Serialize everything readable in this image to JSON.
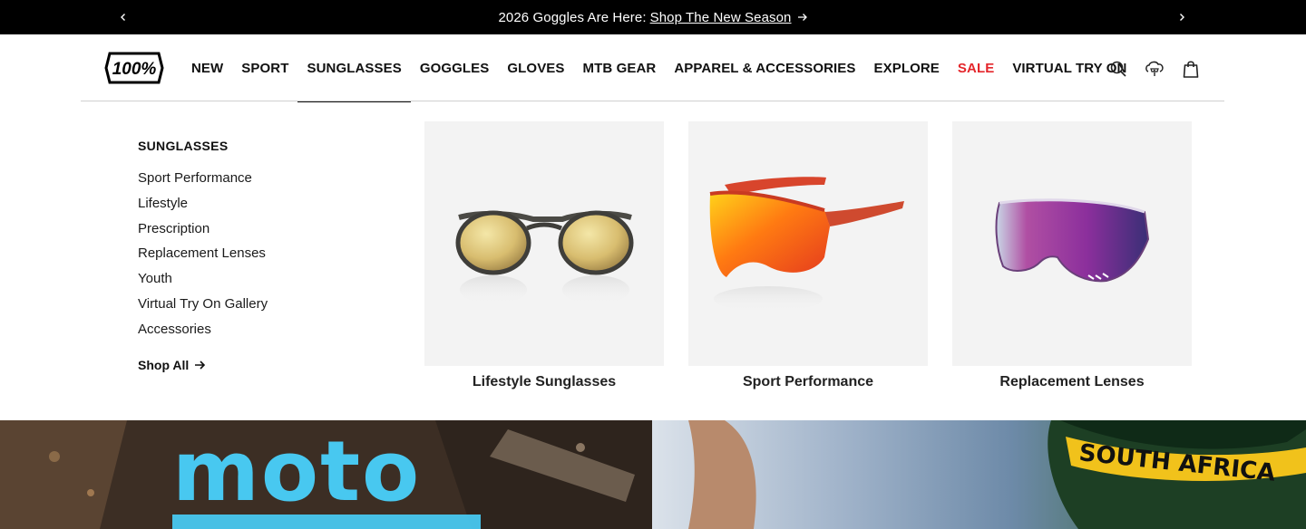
{
  "announcement": {
    "text": "2026 Goggles Are Here:",
    "link": "Shop The New Season",
    "prev_icon": "chevron-left-icon",
    "next_icon": "chevron-right-icon"
  },
  "brand": {
    "logo_text": "100%"
  },
  "nav": {
    "items": [
      {
        "label": "NEW"
      },
      {
        "label": "SPORT"
      },
      {
        "label": "SUNGLASSES"
      },
      {
        "label": "GOGGLES"
      },
      {
        "label": "GLOVES"
      },
      {
        "label": "MTB GEAR"
      },
      {
        "label": "APPAREL & ACCESSORIES"
      },
      {
        "label": "EXPLORE"
      },
      {
        "label": "SALE"
      },
      {
        "label": "VIRTUAL TRY ON"
      }
    ],
    "active_index": 2,
    "sale_color": "#e4262b"
  },
  "header_icons": [
    "search-icon",
    "try-on-icon",
    "bag-icon"
  ],
  "mega_menu": {
    "title": "SUNGLASSES",
    "links": [
      "Sport Performance",
      "Lifestyle",
      "Prescription",
      "Replacement Lenses",
      "Youth",
      "Virtual Try On Gallery",
      "Accessories"
    ],
    "shop_all": "Shop All",
    "cards": [
      {
        "caption": "Lifestyle Sunglasses"
      },
      {
        "caption": "Sport Performance"
      },
      {
        "caption": "Replacement Lenses"
      }
    ]
  },
  "hero": {
    "left_text": "moto",
    "right_text": "SOUTH AFRICA"
  }
}
